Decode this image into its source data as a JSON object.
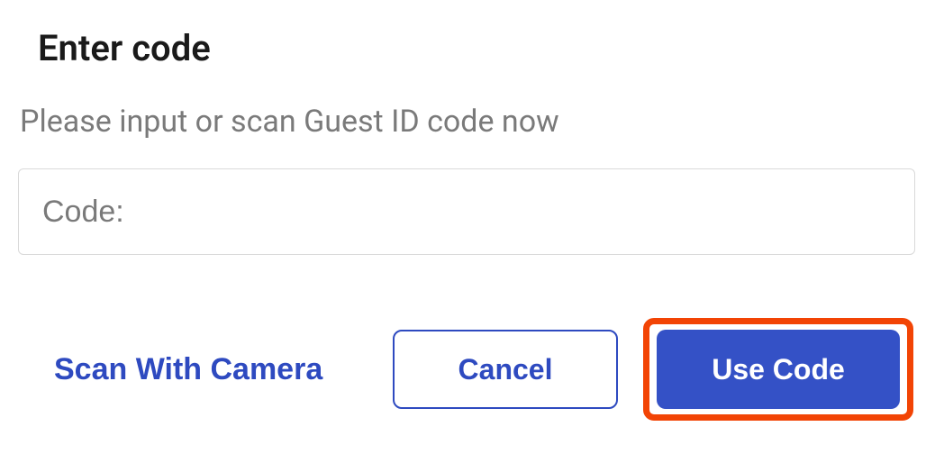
{
  "dialog": {
    "title": "Enter code",
    "subtitle": "Please input or scan Guest ID code now"
  },
  "input": {
    "placeholder": "Code:",
    "value": ""
  },
  "actions": {
    "scan_label": "Scan With Camera",
    "cancel_label": "Cancel",
    "use_code_label": "Use Code"
  },
  "colors": {
    "accent": "#3451c6",
    "highlight_border": "#f24405"
  }
}
